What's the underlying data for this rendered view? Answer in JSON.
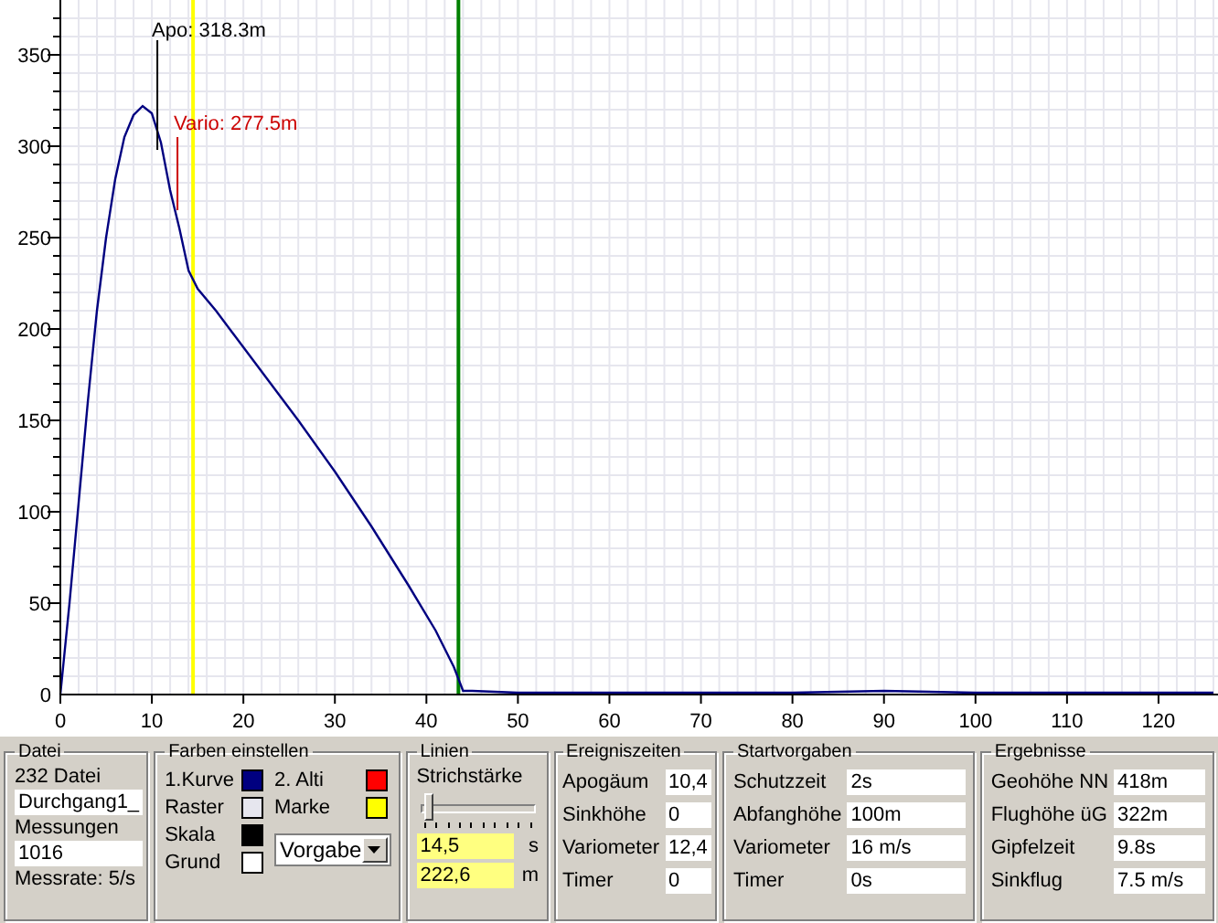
{
  "chart": {
    "chart_data": {
      "type": "line",
      "x": [
        0,
        1,
        2,
        3,
        4,
        5,
        6,
        7,
        8,
        9,
        10,
        11,
        12,
        13,
        14,
        15,
        17,
        20,
        23,
        26,
        30,
        34,
        38,
        41,
        43,
        44,
        45,
        50,
        60,
        70,
        80,
        90,
        100,
        110,
        120,
        126
      ],
      "series": [
        {
          "color": "#000080",
          "values": [
            0,
            50,
            105,
            160,
            210,
            250,
            282,
            305,
            317,
            322,
            318,
            302,
            276,
            255,
            232,
            222,
            210,
            190,
            170,
            150,
            122,
            92,
            60,
            35,
            15,
            2,
            2,
            1,
            1,
            1,
            1,
            2,
            1,
            1,
            1,
            1
          ]
        }
      ],
      "xlim": [
        0,
        126.5
      ],
      "ylim": [
        0,
        380
      ],
      "xticks": [
        0,
        10,
        20,
        30,
        40,
        50,
        60,
        70,
        80,
        90,
        100,
        110,
        120
      ],
      "yticks": [
        0,
        50,
        100,
        150,
        200,
        250,
        300,
        350
      ],
      "grid": true,
      "ref_lines": [
        {
          "axis": "x",
          "value": 14.5,
          "color": "#ffff00"
        },
        {
          "axis": "x",
          "value": 43.5,
          "color": "#008000"
        }
      ],
      "annotations": [
        "Apo: 318.3m",
        "Vario: 277.5m"
      ]
    }
  },
  "groups": [
    {
      "kind": "file",
      "title": "Datei",
      "rows": [
        {
          "kind": "text",
          "text": "232 Datei"
        },
        {
          "kind": "field",
          "text": "Durchgang1_"
        },
        {
          "kind": "text",
          "text": "Messungen"
        },
        {
          "kind": "field",
          "text": "1016"
        },
        {
          "kind": "text",
          "text": "Messrate: 5/s"
        }
      ]
    },
    {
      "kind": "colors",
      "title": "Farben einstellen",
      "swatches": [
        {
          "label": "1.Kurve",
          "color": "#000080"
        },
        {
          "label": "2. Alti",
          "color": "#ff0000"
        },
        {
          "label": "Raster",
          "color": "#e6e6ee"
        },
        {
          "label": "Marke",
          "color": "#ffff00"
        },
        {
          "label": "Skala",
          "color": "#000000"
        },
        {
          "label": "Grund",
          "color": "#ffffff"
        }
      ],
      "dropdown": "Vorgabe"
    },
    {
      "kind": "lines",
      "title": "Linien",
      "label": "Strichstärke",
      "slider": {
        "level": 0.03
      },
      "fields": [
        {
          "value": "14,5",
          "unit": "s"
        },
        {
          "value": "222,6",
          "unit": "m"
        }
      ]
    },
    {
      "kind": "table",
      "title": "Ereigniszeiten",
      "rows": [
        {
          "label": "Apogäum",
          "value": "10,4"
        },
        {
          "label": "Sinkhöhe",
          "value": "0"
        },
        {
          "label": "Variometer",
          "value": "12,4"
        },
        {
          "label": "Timer",
          "value": "0"
        }
      ]
    },
    {
      "kind": "table",
      "title": "Startvorgaben",
      "rows": [
        {
          "label": "Schutzzeit",
          "value": "2s"
        },
        {
          "label": "Abfanghöhe",
          "value": "100m"
        },
        {
          "label": "Variometer",
          "value": "16 m/s"
        },
        {
          "label": "Timer",
          "value": "0s"
        }
      ]
    },
    {
      "kind": "table",
      "title": "Ergebnisse",
      "rows": [
        {
          "label": "Geohöhe NN",
          "value": "418m"
        },
        {
          "label": "Flughöhe üG",
          "value": "322m"
        },
        {
          "label": "Gipfelzeit",
          "value": "9.8s"
        },
        {
          "label": "Sinkflug",
          "value": "7.5 m/s"
        }
      ]
    }
  ]
}
